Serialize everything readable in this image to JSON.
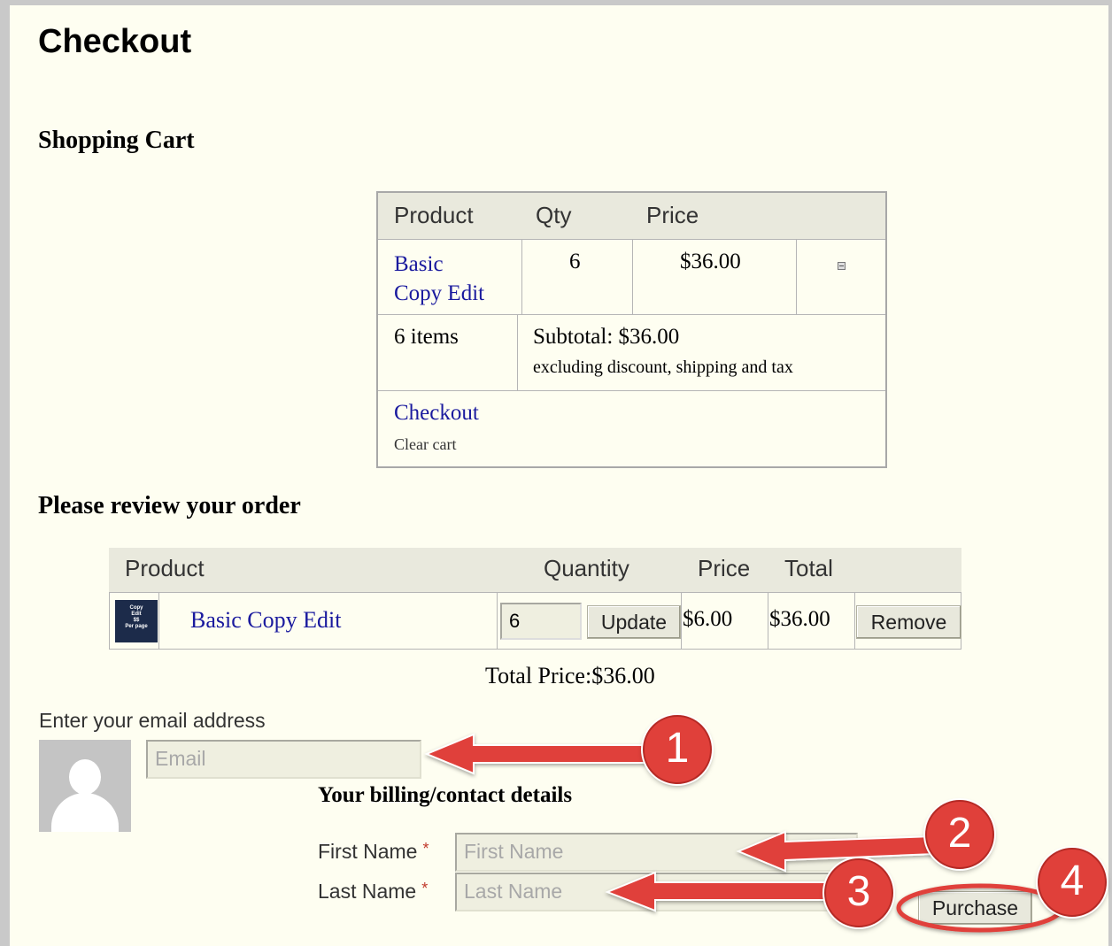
{
  "page": {
    "title": "Checkout"
  },
  "shopping_cart": {
    "heading": "Shopping Cart",
    "columns": [
      "Product",
      "Qty",
      "Price"
    ],
    "item": {
      "name_line1": "Basic",
      "name_line2": "Copy Edit",
      "qty": "6",
      "price": "$36.00"
    },
    "summary": {
      "items": "6 items",
      "subtotal": "Subtotal: $36.00",
      "note": "excluding discount, shipping and tax"
    },
    "checkout_link": "Checkout",
    "clear_cart_link": "Clear cart"
  },
  "review": {
    "heading": "Please review your order",
    "columns": [
      "Product",
      "Quantity",
      "Price",
      "Total"
    ],
    "row": {
      "thumbnail_text": "Copy Edit $$ Per page",
      "product": "Basic Copy Edit",
      "quantity": "6",
      "update_label": "Update",
      "price": "$6.00",
      "total": "$36.00",
      "remove_label": "Remove"
    },
    "total_price": "Total Price:$36.00"
  },
  "email": {
    "label": "Enter your email address",
    "placeholder": "Email"
  },
  "billing": {
    "heading": "Your billing/contact details",
    "first_name_label": "First Name",
    "first_name_placeholder": "First Name",
    "last_name_label": "Last Name",
    "last_name_placeholder": "Last Name",
    "required_marker": "*"
  },
  "purchase_label": "Purchase",
  "callouts": [
    "1",
    "2",
    "3",
    "4"
  ],
  "colors": {
    "background": "#fefef1",
    "link": "#1a1a9e",
    "annotation": "#e0403a",
    "header_bg": "#e9e9dd"
  }
}
